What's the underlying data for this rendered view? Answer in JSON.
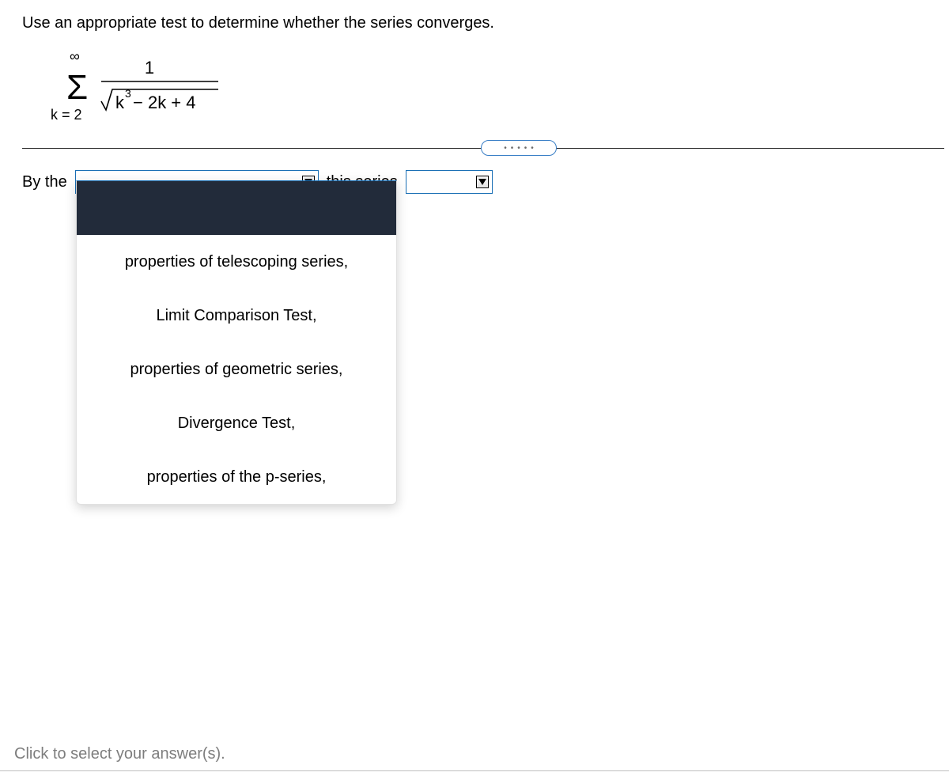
{
  "question": "Use an appropriate test to determine whether the series converges.",
  "formula": {
    "upper": "∞",
    "lower": "k = 2",
    "numerator": "1",
    "radicand_left": "k",
    "radicand_exp": "3",
    "radicand_right": " − 2k + 4"
  },
  "pill_dots": "•••••",
  "answer": {
    "prefix": "By the",
    "middle": "this series"
  },
  "dropdown1": {
    "selected_index": 0,
    "options": [
      "",
      "properties of telescoping series,",
      "Limit Comparison Test,",
      "properties of geometric series,",
      "Divergence Test,",
      "properties of the p-series,"
    ]
  },
  "footer": "Click to select your answer(s)."
}
